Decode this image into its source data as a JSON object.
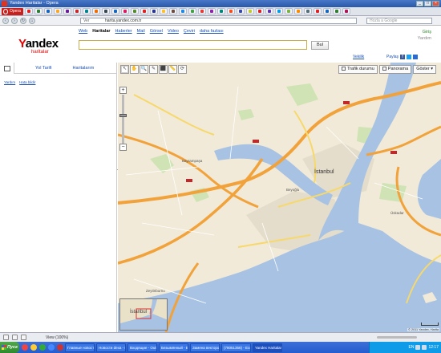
{
  "window": {
    "title": "Yandex Haritalar - Opera"
  },
  "opera_menu": {
    "label": "Opera"
  },
  "tabs": [
    {
      "color": "#e02020"
    },
    {
      "color": "#2e7d32"
    },
    {
      "color": "#1565c0"
    },
    {
      "color": "#f9a825"
    },
    {
      "color": "#6a1b9a"
    },
    {
      "color": "#c62828"
    },
    {
      "color": "#00838f"
    },
    {
      "color": "#ef6c00"
    },
    {
      "color": "#37474f"
    },
    {
      "color": "#1565c0"
    },
    {
      "color": "#d81b60"
    },
    {
      "color": "#558b2f"
    },
    {
      "color": "#e02020"
    },
    {
      "color": "#283593"
    },
    {
      "color": "#fbc02d"
    },
    {
      "color": "#6d4c41"
    },
    {
      "color": "#1e88e5"
    },
    {
      "color": "#43a047"
    },
    {
      "color": "#e53935"
    },
    {
      "color": "#8e24aa"
    },
    {
      "color": "#00897b"
    },
    {
      "color": "#f4511e"
    },
    {
      "color": "#3949ab"
    },
    {
      "color": "#c0ca33"
    },
    {
      "color": "#e02020"
    },
    {
      "color": "#5e35b1"
    },
    {
      "color": "#039be5"
    },
    {
      "color": "#7cb342"
    },
    {
      "color": "#fb8c00"
    },
    {
      "color": "#546e7a"
    },
    {
      "color": "#e02020"
    },
    {
      "color": "#1565c0"
    },
    {
      "color": "#2e7d32"
    },
    {
      "color": "#ad1457"
    }
  ],
  "address": {
    "badge": "Ver",
    "url": "harita.yandex.com.tr",
    "search_placeholder": "Hozla a Google"
  },
  "logo": {
    "first": "Y",
    "rest": "andex",
    "sub": "haritalar"
  },
  "service_nav": [
    {
      "label": "Web",
      "active": false
    },
    {
      "label": "Haritalar",
      "active": true
    },
    {
      "label": "Haberler",
      "active": false
    },
    {
      "label": "Mail",
      "active": false
    },
    {
      "label": "Görsel",
      "active": false
    },
    {
      "label": "Video",
      "active": false
    },
    {
      "label": "Çeviri",
      "active": false
    },
    {
      "label": "daha fazlası",
      "active": false
    }
  ],
  "search": {
    "value": "",
    "button": "Bul"
  },
  "user": {
    "login": "Giriş",
    "help": "Yardım"
  },
  "share": {
    "label": "Paylaş",
    "vekil": "Vekilik"
  },
  "left_tabs": {
    "route": "Yol Tarifi",
    "my_maps": "Haritalarım"
  },
  "left_links": [
    "Yardım",
    "Hata bildir"
  ],
  "map_toolbar": [
    "↖",
    "✋",
    "🔍",
    "✎",
    "⬛",
    "📏",
    "⟳"
  ],
  "map_controls": {
    "traffic": "Trafik durumu",
    "panorama": "Panorama",
    "show": "Göster"
  },
  "map_labels": {
    "beyoglu": "Beyoğlu",
    "istanbul": "İstanbul",
    "bayrampasa": "Bayrampaşa",
    "zeytinburnu": "Zeytinburnu",
    "uskudar": "Üsküdar",
    "minimap": "İstanbul"
  },
  "copyright": "© 2011 Yandex, Harita",
  "status": {
    "view": "View (100%)"
  },
  "taskbar": {
    "start": "Пуск",
    "items": [
      {
        "label": "Главные новости",
        "active": false
      },
      {
        "label": "Новости dexa - Mi",
        "active": false
      },
      {
        "label": "Входящие - Outloo",
        "active": false
      },
      {
        "label": "Безымянный - Б.е.",
        "active": false
      },
      {
        "label": "Замена векторов",
        "active": false
      },
      {
        "label": "(78051356) - Eco",
        "active": false
      },
      {
        "label": "Yandex Haritalar",
        "active": true
      }
    ],
    "clock": "12:17",
    "lang": "EN"
  }
}
